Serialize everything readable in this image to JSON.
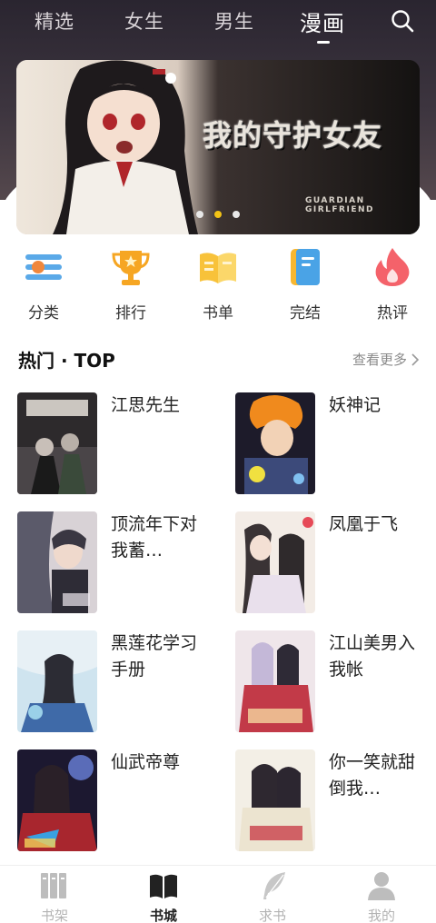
{
  "top_tabs": {
    "items": [
      "精选",
      "女生",
      "男生",
      "漫画"
    ],
    "active": "漫画"
  },
  "banner": {
    "title": "我的守护女友",
    "subtitle": "GUARDIAN GIRLFRIEND",
    "dots": 3,
    "active_dot": 2
  },
  "categories": [
    {
      "label": "分类",
      "icon": "category-icon"
    },
    {
      "label": "排行",
      "icon": "trophy-icon"
    },
    {
      "label": "书单",
      "icon": "booklist-icon"
    },
    {
      "label": "完结",
      "icon": "finished-book-icon"
    },
    {
      "label": "热评",
      "icon": "flame-icon"
    }
  ],
  "section": {
    "title": "热门 · TOP",
    "more": "查看更多"
  },
  "comics": [
    {
      "title": "江思先生"
    },
    {
      "title": "妖神记"
    },
    {
      "title": "顶流年下对我蓄…"
    },
    {
      "title": "凤凰于飞"
    },
    {
      "title": "黑莲花学习手册"
    },
    {
      "title": "江山美男入我帐"
    },
    {
      "title": "仙武帝尊"
    },
    {
      "title": "你一笑就甜倒我…"
    }
  ],
  "bottom_nav": {
    "items": [
      {
        "label": "书架",
        "icon": "bookshelf-icon"
      },
      {
        "label": "书城",
        "icon": "bookstore-icon"
      },
      {
        "label": "求书",
        "icon": "feather-icon"
      },
      {
        "label": "我的",
        "icon": "profile-icon"
      }
    ],
    "active": "书城"
  },
  "colors": {
    "accent_yellow": "#f3c316",
    "header_dark": "#2a2530",
    "nav_inactive": "#b3b3b3"
  }
}
